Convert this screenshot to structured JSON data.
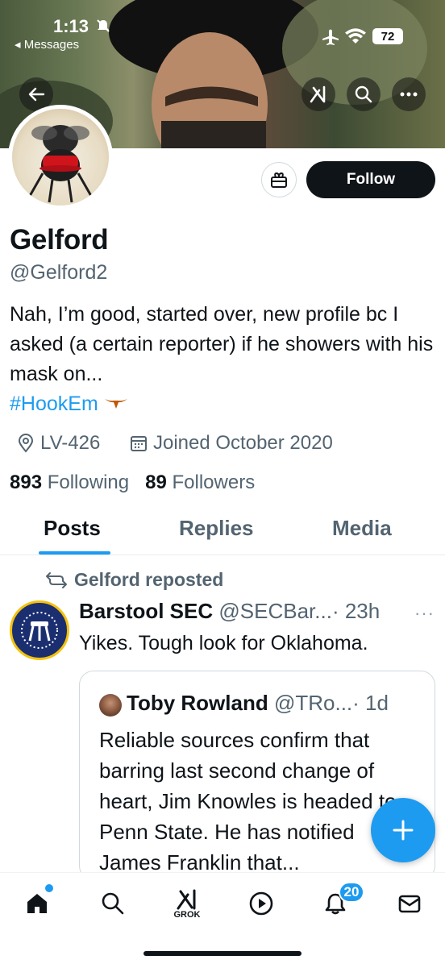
{
  "status_bar": {
    "time": "1:13",
    "back_app": "Messages",
    "battery": "72"
  },
  "profile": {
    "name": "Gelford",
    "handle": "@Gelford2",
    "bio": "Nah, I’m good, started over, new profile bc I asked (a certain reporter) if he showers with his mask on...",
    "hashtag": "#HookEm",
    "location": "LV-426",
    "joined": "Joined October 2020",
    "following_count": "893",
    "following_label": "Following",
    "followers_count": "89",
    "followers_label": "Followers",
    "follow_button": "Follow"
  },
  "tabs": [
    {
      "label": "Posts",
      "active": true
    },
    {
      "label": "Replies",
      "active": false
    },
    {
      "label": "Media",
      "active": false
    }
  ],
  "post": {
    "repost_label": "Gelford reposted",
    "author": "Barstool SEC",
    "handle": "@SECBar...",
    "time": "· 23h",
    "text": "Yikes. Tough look for Oklahoma.",
    "avatar_text": "",
    "quote": {
      "author": "Toby Rowland",
      "handle": "@TRo...",
      "time": "· 1d",
      "text": "Reliable sources confirm that barring last second change of heart, Jim Knowles is headed to Penn State. He has notified James Franklin that..."
    }
  },
  "nav": {
    "grok_label": "GROK",
    "notifications_badge": "20"
  },
  "colors": {
    "accent": "#1d9bf0",
    "text": "#0f1419",
    "muted": "#536471"
  }
}
